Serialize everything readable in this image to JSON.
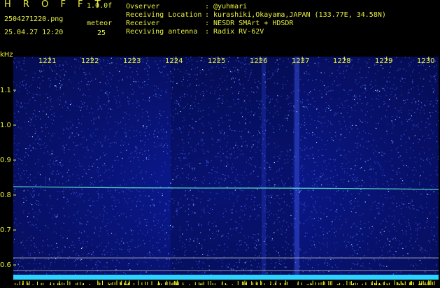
{
  "header": {
    "title": "H R O F F T",
    "version": "1.0.0f",
    "filename": "2504271220.png",
    "mode": "meteor",
    "datetime": "25.04.27 12:20",
    "count": "25"
  },
  "info": [
    {
      "key": "Ovserver",
      "value": ": @yuhmari"
    },
    {
      "key": "Receiving Location",
      "value": ": kurashiki,Okayama,JAPAN (133.77E, 34.58N)"
    },
    {
      "key": "Receiver",
      "value": ": NESDR SMArt + HDSDR"
    },
    {
      "key": "Recviving antenna",
      "value": ": Radix RV-62V"
    }
  ],
  "axis": {
    "unit": "kHz",
    "y_ticks": [
      "1.1",
      "1.0",
      "0.9",
      "0.8",
      "0.7",
      "0.6"
    ],
    "x_ticks": [
      "1221",
      "1222",
      "1223",
      "1224",
      "1225",
      "1226",
      "1227",
      "1228",
      "1229",
      "1230"
    ]
  },
  "colors": {
    "text": "#e8f040",
    "background": "#000000",
    "spectrogram": "#08126e",
    "trail": "#5ff0d0",
    "bar": "#2ad4ff",
    "bar_peaks": "#f0f020"
  }
}
